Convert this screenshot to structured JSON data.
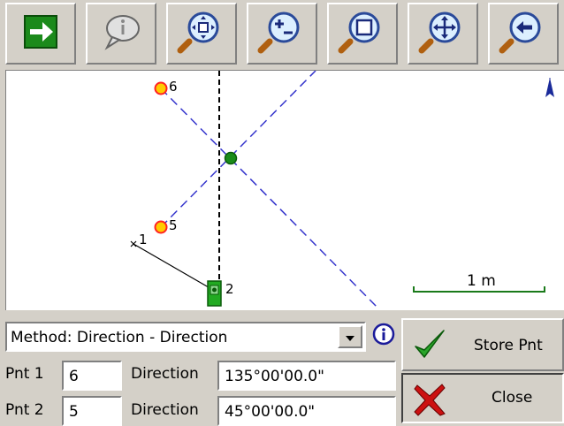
{
  "toolbar": {
    "buttons": [
      {
        "name": "go-arrow-icon"
      },
      {
        "name": "speech-bubble-icon"
      },
      {
        "name": "zoom-extents-icon"
      },
      {
        "name": "zoom-in-out-icon"
      },
      {
        "name": "zoom-window-icon"
      },
      {
        "name": "pan-icon"
      },
      {
        "name": "zoom-previous-icon"
      }
    ]
  },
  "map": {
    "points": [
      {
        "label": "6"
      },
      {
        "label": "5"
      },
      {
        "label": "1"
      },
      {
        "label": "2"
      }
    ],
    "scale_label": "1 m",
    "colors": {
      "dash_line": "#3333cc",
      "point_fill": "#ffcc00",
      "point_ring": "#ff2222",
      "intersection": "#1a8c1a",
      "instrument": "#22aa22"
    }
  },
  "method": {
    "value": "Method: Direction - Direction"
  },
  "rows": [
    {
      "pnt_label": "Pnt 1",
      "pnt_value": "6",
      "dir_label": "Direction",
      "dir_value": "135°00'00.0\""
    },
    {
      "pnt_label": "Pnt 2",
      "pnt_value": "5",
      "dir_label": "Direction",
      "dir_value": "45°00'00.0\""
    }
  ],
  "actions": {
    "store_label": "Store Pnt",
    "close_label": "Close"
  }
}
